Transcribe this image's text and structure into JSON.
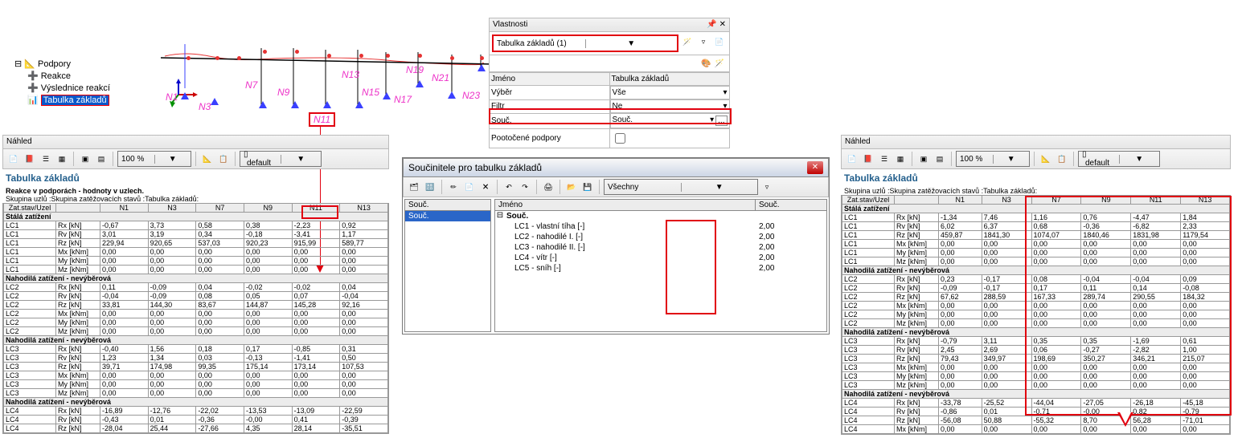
{
  "tree": {
    "root": "Podpory",
    "items": [
      "Reakce",
      "Výslednice reakcí",
      "Tabulka základů"
    ]
  },
  "anno": {
    "n1": "N1",
    "n3": "N3",
    "n7": "N7",
    "n9": "N9",
    "n11": "N11",
    "n13": "N13",
    "n15": "N15",
    "n17": "N17",
    "n19": "N19",
    "n21": "N21",
    "n23": "N23"
  },
  "props": {
    "title": "Vlastnosti",
    "selector": "Tabulka základů (1)",
    "name_label": "Jméno",
    "name_val": "Tabulka základů",
    "vyber_label": "Výběr",
    "vyber_val": "Vše",
    "filtr_label": "Filtr",
    "filtr_val": "Ne",
    "souc_label": "Souč.",
    "souc_val": "Souč.",
    "poot_label": "Pootočené podpory"
  },
  "nahled": "Náhled",
  "zoom": "100 %",
  "default": "default",
  "table_left": {
    "title": "Tabulka základů",
    "sub1": "Reakce v podporách - hodnoty v uzlech.",
    "sub2": "Skupina uzlů :Skupina zatěžovacích stavů :Tabulka základů:",
    "hdr": [
      "Zat.stav/Uzel",
      "",
      "N1",
      "N3",
      "N7",
      "N9",
      "N11",
      "N13"
    ],
    "rows": [
      {
        "g": "Stálá zatížení"
      },
      {
        "c": [
          "LC1",
          "Rx [kN]",
          "-0,67",
          "3,73",
          "0,58",
          "0,38",
          "-2,23",
          "0,92"
        ]
      },
      {
        "c": [
          "LC1",
          "Rv [kN]",
          "3,01",
          "3,19",
          "0,34",
          "-0,18",
          "-3,41",
          "1,17"
        ]
      },
      {
        "c": [
          "LC1",
          "Rz [kN]",
          "229,94",
          "920,65",
          "537,03",
          "920,23",
          "915,99",
          "589,77"
        ]
      },
      {
        "c": [
          "LC1",
          "Mx [kNm]",
          "0,00",
          "0,00",
          "0,00",
          "0,00",
          "0,00",
          "0,00"
        ]
      },
      {
        "c": [
          "LC1",
          "My [kNm]",
          "0,00",
          "0,00",
          "0,00",
          "0,00",
          "0,00",
          "0,00"
        ]
      },
      {
        "c": [
          "LC1",
          "Mz [kNm]",
          "0,00",
          "0,00",
          "0,00",
          "0,00",
          "0,00",
          "0,00"
        ]
      },
      {
        "g": "Nahodilá zatížení - nevýběrová"
      },
      {
        "c": [
          "LC2",
          "Rx [kN]",
          "0,11",
          "-0,09",
          "0,04",
          "-0,02",
          "-0,02",
          "0,04"
        ]
      },
      {
        "c": [
          "LC2",
          "Rv [kN]",
          "-0,04",
          "-0,09",
          "0,08",
          "0,05",
          "0,07",
          "-0,04"
        ]
      },
      {
        "c": [
          "LC2",
          "Rz [kN]",
          "33,81",
          "144,30",
          "83,67",
          "144,87",
          "145,28",
          "92,16"
        ]
      },
      {
        "c": [
          "LC2",
          "Mx [kNm]",
          "0,00",
          "0,00",
          "0,00",
          "0,00",
          "0,00",
          "0,00"
        ]
      },
      {
        "c": [
          "LC2",
          "My [kNm]",
          "0,00",
          "0,00",
          "0,00",
          "0,00",
          "0,00",
          "0,00"
        ]
      },
      {
        "c": [
          "LC2",
          "Mz [kNm]",
          "0,00",
          "0,00",
          "0,00",
          "0,00",
          "0,00",
          "0,00"
        ]
      },
      {
        "g": "Nahodilá zatížení - nevýběrová"
      },
      {
        "c": [
          "LC3",
          "Rx [kN]",
          "-0,40",
          "1,56",
          "0,18",
          "0,17",
          "-0,85",
          "0,31"
        ]
      },
      {
        "c": [
          "LC3",
          "Rv [kN]",
          "1,23",
          "1,34",
          "0,03",
          "-0,13",
          "-1,41",
          "0,50"
        ]
      },
      {
        "c": [
          "LC3",
          "Rz [kN]",
          "39,71",
          "174,98",
          "99,35",
          "175,14",
          "173,14",
          "107,53"
        ]
      },
      {
        "c": [
          "LC3",
          "Mx [kNm]",
          "0,00",
          "0,00",
          "0,00",
          "0,00",
          "0,00",
          "0,00"
        ]
      },
      {
        "c": [
          "LC3",
          "My [kNm]",
          "0,00",
          "0,00",
          "0,00",
          "0,00",
          "0,00",
          "0,00"
        ]
      },
      {
        "c": [
          "LC3",
          "Mz [kNm]",
          "0,00",
          "0,00",
          "0,00",
          "0,00",
          "0,00",
          "0,00"
        ]
      },
      {
        "g": "Nahodilá zatížení - nevýběrová"
      },
      {
        "c": [
          "LC4",
          "Rx [kN]",
          "-16,89",
          "-12,76",
          "-22,02",
          "-13,53",
          "-13,09",
          "-22,59"
        ]
      },
      {
        "c": [
          "LC4",
          "Rv [kN]",
          "-0,43",
          "0,01",
          "-0,36",
          "-0,00",
          "0,41",
          "-0,39"
        ]
      },
      {
        "c": [
          "LC4",
          "Rz [kN]",
          "-28,04",
          "25,44",
          "-27,66",
          "4,35",
          "28,14",
          "-35,51"
        ]
      }
    ]
  },
  "table_right": {
    "title": "Tabulka základů",
    "sub2": "Skupina uzlů :Skupina zatěžovacích stavů :Tabulka základů:",
    "hdr": [
      "Zat.stav/Uzel",
      "",
      "N1",
      "N3",
      "N7",
      "N9",
      "N11",
      "N13"
    ],
    "rows": [
      {
        "g": "Stálá zatížení"
      },
      {
        "c": [
          "LC1",
          "Rx [kN]",
          "-1,34",
          "7,46",
          "1,16",
          "0,76",
          "-4,47",
          "1,84"
        ]
      },
      {
        "c": [
          "LC1",
          "Rv [kN]",
          "6,02",
          "6,37",
          "0,68",
          "-0,36",
          "-6,82",
          "2,33"
        ]
      },
      {
        "c": [
          "LC1",
          "Rz [kN]",
          "459,87",
          "1841,30",
          "1074,07",
          "1840,46",
          "1831,98",
          "1179,54"
        ]
      },
      {
        "c": [
          "LC1",
          "Mx [kNm]",
          "0,00",
          "0,00",
          "0,00",
          "0,00",
          "0,00",
          "0,00"
        ]
      },
      {
        "c": [
          "LC1",
          "My [kNm]",
          "0,00",
          "0,00",
          "0,00",
          "0,00",
          "0,00",
          "0,00"
        ]
      },
      {
        "c": [
          "LC1",
          "Mz [kNm]",
          "0,00",
          "0,00",
          "0,00",
          "0,00",
          "0,00",
          "0,00"
        ]
      },
      {
        "g": "Nahodilá zatížení - nevýběrová"
      },
      {
        "c": [
          "LC2",
          "Rx [kN]",
          "0,23",
          "-0,17",
          "0,08",
          "-0,04",
          "-0,04",
          "0,09"
        ]
      },
      {
        "c": [
          "LC2",
          "Rv [kN]",
          "-0,09",
          "-0,17",
          "0,17",
          "0,11",
          "0,14",
          "-0,08"
        ]
      },
      {
        "c": [
          "LC2",
          "Rz [kN]",
          "67,62",
          "288,59",
          "167,33",
          "289,74",
          "290,55",
          "184,32"
        ]
      },
      {
        "c": [
          "LC2",
          "Mx [kNm]",
          "0,00",
          "0,00",
          "0,00",
          "0,00",
          "0,00",
          "0,00"
        ]
      },
      {
        "c": [
          "LC2",
          "My [kNm]",
          "0,00",
          "0,00",
          "0,00",
          "0,00",
          "0,00",
          "0,00"
        ]
      },
      {
        "c": [
          "LC2",
          "Mz [kNm]",
          "0,00",
          "0,00",
          "0,00",
          "0,00",
          "0,00",
          "0,00"
        ]
      },
      {
        "g": "Nahodilá zatížení - nevýběrová"
      },
      {
        "c": [
          "LC3",
          "Rx [kN]",
          "-0,79",
          "3,11",
          "0,35",
          "0,35",
          "-1,69",
          "0,61"
        ]
      },
      {
        "c": [
          "LC3",
          "Rv [kN]",
          "2,45",
          "2,69",
          "0,06",
          "-0,27",
          "-2,82",
          "1,00"
        ]
      },
      {
        "c": [
          "LC3",
          "Rz [kN]",
          "79,43",
          "349,97",
          "198,69",
          "350,27",
          "346,21",
          "215,07"
        ]
      },
      {
        "c": [
          "LC3",
          "Mx [kNm]",
          "0,00",
          "0,00",
          "0,00",
          "0,00",
          "0,00",
          "0,00"
        ]
      },
      {
        "c": [
          "LC3",
          "My [kNm]",
          "0,00",
          "0,00",
          "0,00",
          "0,00",
          "0,00",
          "0,00"
        ]
      },
      {
        "c": [
          "LC3",
          "Mz [kNm]",
          "0,00",
          "0,00",
          "0,00",
          "0,00",
          "0,00",
          "0,00"
        ]
      },
      {
        "g": "Nahodilá zatížení - nevýběrová"
      },
      {
        "c": [
          "LC4",
          "Rx [kN]",
          "-33,78",
          "-25,52",
          "-44,04",
          "-27,05",
          "-26,18",
          "-45,18"
        ]
      },
      {
        "c": [
          "LC4",
          "Rv [kN]",
          "-0,86",
          "0,01",
          "-0,71",
          "-0,00",
          "0,82",
          "-0,79"
        ]
      },
      {
        "c": [
          "LC4",
          "Rz [kN]",
          "-56,08",
          "50,88",
          "-55,32",
          "8,70",
          "56,28",
          "-71,01"
        ]
      },
      {
        "c": [
          "LC4",
          "Mx [kNm]",
          "0,00",
          "0,00",
          "0,00",
          "0,00",
          "0,00",
          "0,00"
        ]
      }
    ]
  },
  "coef": {
    "title": "Součinitele pro tabulku základů",
    "all": "Všechny",
    "col_souc": "Souč.",
    "col_jm": "Jméno",
    "col_val": "Souč.",
    "sel": "Souč.",
    "bold": "Souč.",
    "rows": [
      {
        "n": "LC1 - vlastní tíha [-]",
        "v": "2,00"
      },
      {
        "n": "LC2 - nahodilé I. [-]",
        "v": "2,00"
      },
      {
        "n": "LC3 - nahodilé II. [-]",
        "v": "2,00"
      },
      {
        "n": "LC4 - vítr [-]",
        "v": "2,00"
      },
      {
        "n": "LC5 - sníh [-]",
        "v": "2,00"
      }
    ]
  }
}
